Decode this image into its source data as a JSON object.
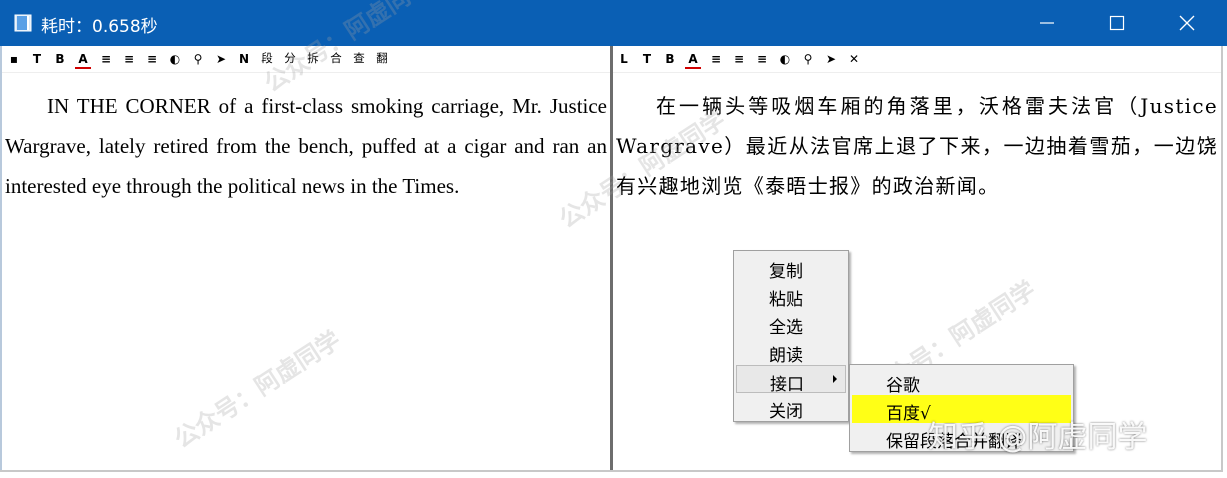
{
  "window": {
    "title": "耗时：0.658秒",
    "icon": "book-icon",
    "controls": [
      "minimize-icon",
      "maximize-icon",
      "close-icon"
    ]
  },
  "left_pane": {
    "toolbar": [
      {
        "name": "dot",
        "glyph": "▪"
      },
      {
        "name": "t",
        "glyph": "T"
      },
      {
        "name": "bold",
        "glyph": "B"
      },
      {
        "name": "font-color",
        "glyph": "A"
      },
      {
        "name": "align-left",
        "glyph": "≡"
      },
      {
        "name": "align-center",
        "glyph": "≡"
      },
      {
        "name": "align-justify",
        "glyph": "≡"
      },
      {
        "name": "palette",
        "glyph": "◐"
      },
      {
        "name": "search",
        "glyph": "⚲"
      },
      {
        "name": "send",
        "glyph": "➤"
      },
      {
        "name": "n",
        "glyph": "N"
      },
      {
        "name": "duan",
        "glyph": "段"
      },
      {
        "name": "fen",
        "glyph": "分"
      },
      {
        "name": "chai",
        "glyph": "拆"
      },
      {
        "name": "he",
        "glyph": "合"
      },
      {
        "name": "cha",
        "glyph": "查"
      },
      {
        "name": "fan",
        "glyph": "翻"
      }
    ],
    "text": "IN THE CORNER of a first-class smoking carriage, Mr. Justice Wargrave, lately retired from the bench, puffed at a cigar and ran an interested eye through the political news in the Times."
  },
  "right_pane": {
    "toolbar": [
      {
        "name": "l",
        "glyph": "L"
      },
      {
        "name": "t",
        "glyph": "T"
      },
      {
        "name": "bold",
        "glyph": "B"
      },
      {
        "name": "font-color",
        "glyph": "A"
      },
      {
        "name": "align-left",
        "glyph": "≡"
      },
      {
        "name": "align-center",
        "glyph": "≡"
      },
      {
        "name": "align-justify",
        "glyph": "≡"
      },
      {
        "name": "palette",
        "glyph": "◐"
      },
      {
        "name": "search",
        "glyph": "⚲"
      },
      {
        "name": "send",
        "glyph": "➤"
      },
      {
        "name": "close",
        "glyph": "✕"
      }
    ],
    "text": "在一辆头等吸烟车厢的角落里，沃格雷夫法官（Justice Wargrave）最近从法官席上退了下来，一边抽着雪茄，一边饶有兴趣地浏览《泰晤士报》的政治新闻。"
  },
  "context_menu": {
    "items": [
      "复制",
      "粘贴",
      "全选",
      "朗读",
      "接口",
      "关闭"
    ],
    "hovered": "接口"
  },
  "submenu": {
    "items": [
      "谷歌",
      "百度√",
      "保留段落合并翻译"
    ],
    "selected": "百度√",
    "highlight_color": "#ffff16"
  },
  "watermarks": {
    "wechat": "公众号：阿虚同学",
    "zhihu": "知乎 @阿虚同学"
  },
  "colors": {
    "titlebar": "#0a5fb4",
    "menu_background": "#f0f0f0",
    "splitter": "#6d6d6d"
  }
}
